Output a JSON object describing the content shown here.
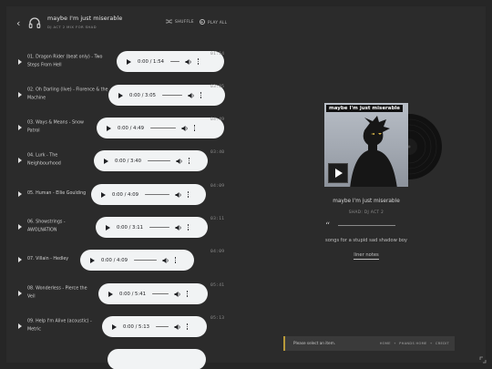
{
  "header": {
    "back_icon": "‹",
    "title": "maybe I'm just miserable",
    "subtitle": "DJ ACT 2 MIX FOR SHAD",
    "shuffle_label": "SHUFFLE",
    "play_all_label": "PLAY ALL"
  },
  "tracks": [
    {
      "name_line1": "01. Dragon Rider (beat only) - Two",
      "name_line2": "Steps From Hell",
      "time": "0:00 / 1:54",
      "duration": "01:54"
    },
    {
      "name_line1": "02. Oh Darling (live) - Florence & the",
      "name_line2": "Machine",
      "time": "0:00 / 3:05",
      "duration": "03:05"
    },
    {
      "name_line1": "03. Ways & Means - Snow",
      "name_line2": "Patrol",
      "time": "0:00 / 4:49",
      "duration": "04:49"
    },
    {
      "name_line1": "04. Lurk - The",
      "name_line2": "Neighbourhood",
      "time": "0:00 / 3:40",
      "duration": "03:40"
    },
    {
      "name_line1": "05. Human - Ellie Goulding",
      "name_line2": "",
      "time": "0:00 / 4:09",
      "duration": "04:09"
    },
    {
      "name_line1": "06. Showstrings -",
      "name_line2": "AWOLNATION",
      "time": "0:00 / 3:11",
      "duration": "03:11"
    },
    {
      "name_line1": "07. Villain - Hedley",
      "name_line2": "",
      "time": "0:00 / 4:09",
      "duration": "04:09"
    },
    {
      "name_line1": "08. Wonderless - Pierce the",
      "name_line2": "Veil",
      "time": "0:00 / 5:41",
      "duration": "05:41"
    },
    {
      "name_line1": "09. Help I'm Alive (acoustic) -",
      "name_line2": "Metric",
      "time": "0:00 / 5:13",
      "duration": "05:13"
    }
  ],
  "cover": {
    "title": "maybe I'm just miserable"
  },
  "info": {
    "mix_title": "maybe I'm just miserable",
    "mix_sub": "SHAD: DJ ACT 2",
    "quote_mark": "“",
    "description": "songs for a stupid sad shadow boy",
    "liner_label": "liner notes"
  },
  "bottombar": {
    "message": "Please select an item.",
    "links": [
      "HOME",
      "PHANDS HOME",
      "CREDIT"
    ]
  },
  "colors": {
    "background": "#262626",
    "panel": "#2b2b2b",
    "player": "#f1f3f4",
    "accent": "#b89a3a"
  }
}
